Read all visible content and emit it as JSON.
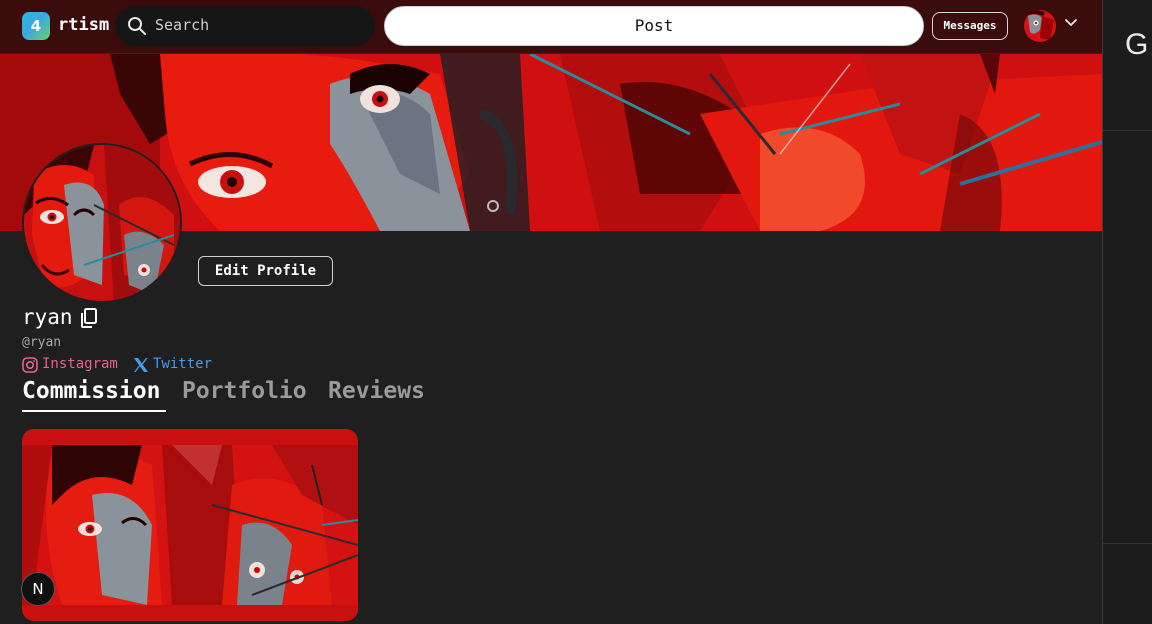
{
  "topbar": {
    "logo_badge": "4",
    "logo_text": "rtism",
    "search_placeholder": "Search",
    "post_label": "Post",
    "messages_label": "Messages"
  },
  "profile": {
    "edit_label": "Edit Profile",
    "username": "ryan",
    "handle": "@ryan",
    "links": [
      {
        "label": "Instagram",
        "icon": "instagram-icon",
        "color": "#e8628a"
      },
      {
        "label": "Twitter",
        "icon": "x-twitter-icon",
        "color": "#3e9ef0"
      }
    ]
  },
  "tabs": [
    {
      "label": "Commission",
      "active": true
    },
    {
      "label": "Portfolio",
      "active": false
    },
    {
      "label": "Reviews",
      "active": false
    }
  ],
  "floating_badge": "N",
  "side_panel": {
    "partial_text": "G"
  },
  "colors": {
    "topbar_bg": "#3a0c0c",
    "page_bg": "#1f1f1f",
    "accent_red": "#c81010",
    "instagram": "#e8628a",
    "twitter": "#3e9ef0"
  }
}
